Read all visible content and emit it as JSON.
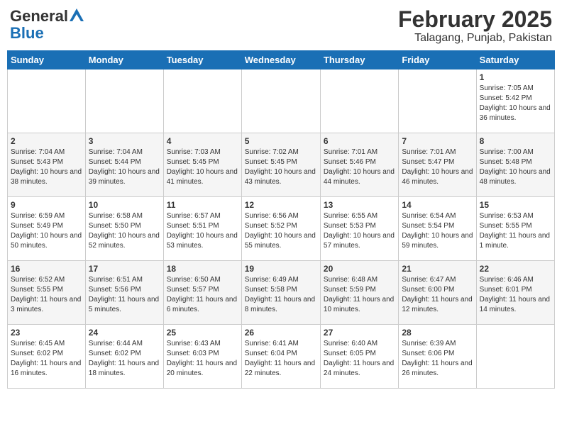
{
  "header": {
    "logo_line1": "General",
    "logo_line2": "Blue",
    "month": "February 2025",
    "location": "Talagang, Punjab, Pakistan"
  },
  "days_of_week": [
    "Sunday",
    "Monday",
    "Tuesday",
    "Wednesday",
    "Thursday",
    "Friday",
    "Saturday"
  ],
  "weeks": [
    [
      {
        "day": "",
        "info": ""
      },
      {
        "day": "",
        "info": ""
      },
      {
        "day": "",
        "info": ""
      },
      {
        "day": "",
        "info": ""
      },
      {
        "day": "",
        "info": ""
      },
      {
        "day": "",
        "info": ""
      },
      {
        "day": "1",
        "info": "Sunrise: 7:05 AM\nSunset: 5:42 PM\nDaylight: 10 hours and 36 minutes."
      }
    ],
    [
      {
        "day": "2",
        "info": "Sunrise: 7:04 AM\nSunset: 5:43 PM\nDaylight: 10 hours and 38 minutes."
      },
      {
        "day": "3",
        "info": "Sunrise: 7:04 AM\nSunset: 5:44 PM\nDaylight: 10 hours and 39 minutes."
      },
      {
        "day": "4",
        "info": "Sunrise: 7:03 AM\nSunset: 5:45 PM\nDaylight: 10 hours and 41 minutes."
      },
      {
        "day": "5",
        "info": "Sunrise: 7:02 AM\nSunset: 5:45 PM\nDaylight: 10 hours and 43 minutes."
      },
      {
        "day": "6",
        "info": "Sunrise: 7:01 AM\nSunset: 5:46 PM\nDaylight: 10 hours and 44 minutes."
      },
      {
        "day": "7",
        "info": "Sunrise: 7:01 AM\nSunset: 5:47 PM\nDaylight: 10 hours and 46 minutes."
      },
      {
        "day": "8",
        "info": "Sunrise: 7:00 AM\nSunset: 5:48 PM\nDaylight: 10 hours and 48 minutes."
      }
    ],
    [
      {
        "day": "9",
        "info": "Sunrise: 6:59 AM\nSunset: 5:49 PM\nDaylight: 10 hours and 50 minutes."
      },
      {
        "day": "10",
        "info": "Sunrise: 6:58 AM\nSunset: 5:50 PM\nDaylight: 10 hours and 52 minutes."
      },
      {
        "day": "11",
        "info": "Sunrise: 6:57 AM\nSunset: 5:51 PM\nDaylight: 10 hours and 53 minutes."
      },
      {
        "day": "12",
        "info": "Sunrise: 6:56 AM\nSunset: 5:52 PM\nDaylight: 10 hours and 55 minutes."
      },
      {
        "day": "13",
        "info": "Sunrise: 6:55 AM\nSunset: 5:53 PM\nDaylight: 10 hours and 57 minutes."
      },
      {
        "day": "14",
        "info": "Sunrise: 6:54 AM\nSunset: 5:54 PM\nDaylight: 10 hours and 59 minutes."
      },
      {
        "day": "15",
        "info": "Sunrise: 6:53 AM\nSunset: 5:55 PM\nDaylight: 11 hours and 1 minute."
      }
    ],
    [
      {
        "day": "16",
        "info": "Sunrise: 6:52 AM\nSunset: 5:55 PM\nDaylight: 11 hours and 3 minutes."
      },
      {
        "day": "17",
        "info": "Sunrise: 6:51 AM\nSunset: 5:56 PM\nDaylight: 11 hours and 5 minutes."
      },
      {
        "day": "18",
        "info": "Sunrise: 6:50 AM\nSunset: 5:57 PM\nDaylight: 11 hours and 6 minutes."
      },
      {
        "day": "19",
        "info": "Sunrise: 6:49 AM\nSunset: 5:58 PM\nDaylight: 11 hours and 8 minutes."
      },
      {
        "day": "20",
        "info": "Sunrise: 6:48 AM\nSunset: 5:59 PM\nDaylight: 11 hours and 10 minutes."
      },
      {
        "day": "21",
        "info": "Sunrise: 6:47 AM\nSunset: 6:00 PM\nDaylight: 11 hours and 12 minutes."
      },
      {
        "day": "22",
        "info": "Sunrise: 6:46 AM\nSunset: 6:01 PM\nDaylight: 11 hours and 14 minutes."
      }
    ],
    [
      {
        "day": "23",
        "info": "Sunrise: 6:45 AM\nSunset: 6:02 PM\nDaylight: 11 hours and 16 minutes."
      },
      {
        "day": "24",
        "info": "Sunrise: 6:44 AM\nSunset: 6:02 PM\nDaylight: 11 hours and 18 minutes."
      },
      {
        "day": "25",
        "info": "Sunrise: 6:43 AM\nSunset: 6:03 PM\nDaylight: 11 hours and 20 minutes."
      },
      {
        "day": "26",
        "info": "Sunrise: 6:41 AM\nSunset: 6:04 PM\nDaylight: 11 hours and 22 minutes."
      },
      {
        "day": "27",
        "info": "Sunrise: 6:40 AM\nSunset: 6:05 PM\nDaylight: 11 hours and 24 minutes."
      },
      {
        "day": "28",
        "info": "Sunrise: 6:39 AM\nSunset: 6:06 PM\nDaylight: 11 hours and 26 minutes."
      },
      {
        "day": "",
        "info": ""
      }
    ]
  ]
}
